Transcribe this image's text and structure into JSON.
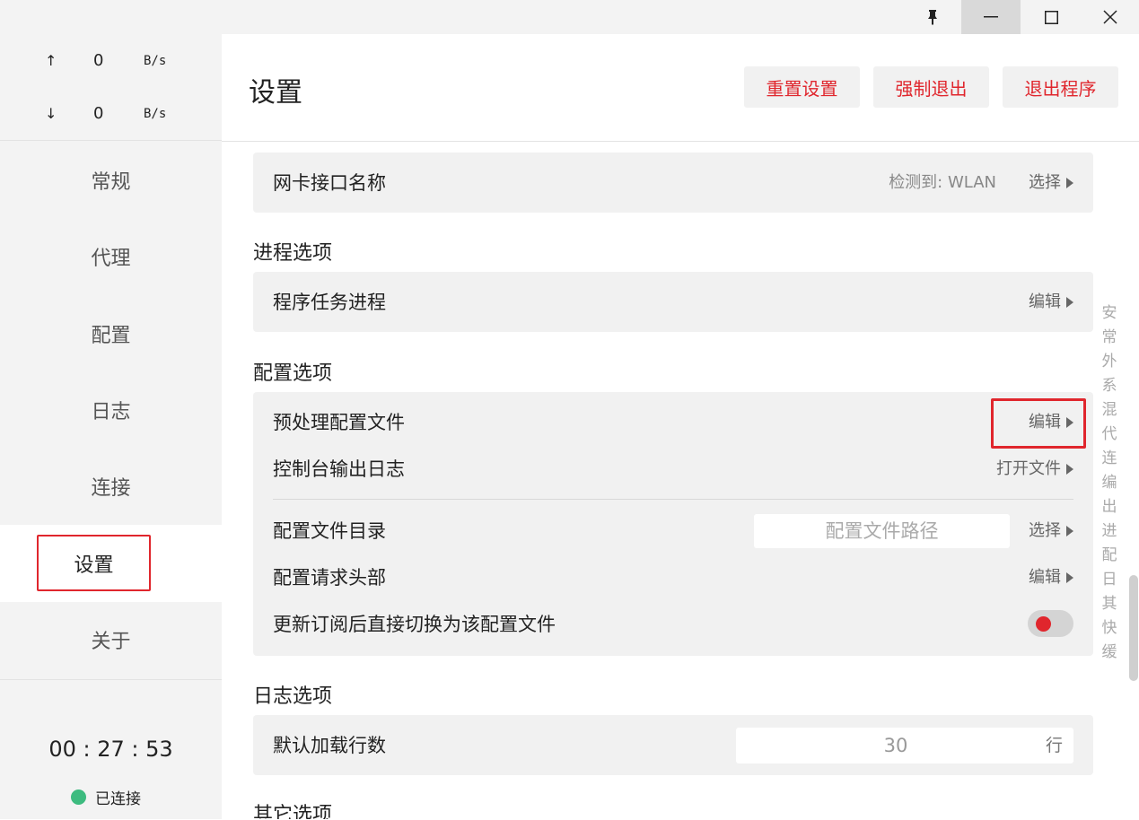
{
  "window": {
    "pin_icon": "pin-icon",
    "minimize_icon": "minimize-icon",
    "maximize_icon": "maximize-icon",
    "close_icon": "close-icon"
  },
  "traffic": {
    "upload": {
      "arrow": "↑",
      "value": "0",
      "unit": "B/s"
    },
    "download": {
      "arrow": "↓",
      "value": "0",
      "unit": "B/s"
    }
  },
  "nav": {
    "items": [
      "常规",
      "代理",
      "配置",
      "日志",
      "连接",
      "设置",
      "关于"
    ],
    "active": "设置"
  },
  "status": {
    "timer": "00 : 27 : 53",
    "connection": "已连接",
    "dot_color": "#3dbb7f"
  },
  "header": {
    "title": "设置",
    "reset_label": "重置设置",
    "force_quit_label": "强制退出",
    "exit_label": "退出程序",
    "accent_color": "#e0262d"
  },
  "settings": {
    "nic": {
      "label": "网卡接口名称",
      "detected": "检测到: WLAN",
      "action": "选择"
    },
    "process_section": "进程选项",
    "process_task": {
      "label": "程序任务进程",
      "action": "编辑"
    },
    "profile_section": "配置选项",
    "preprocess": {
      "label": "预处理配置文件",
      "action": "编辑"
    },
    "console_log": {
      "label": "控制台输出日志",
      "action": "打开文件"
    },
    "profile_dir": {
      "label": "配置文件目录",
      "placeholder": "配置文件路径",
      "action": "选择"
    },
    "request_headers": {
      "label": "配置请求头部",
      "action": "编辑"
    },
    "auto_switch": {
      "label": "更新订阅后直接切换为该配置文件",
      "enabled": false
    },
    "log_section": "日志选项",
    "default_lines": {
      "label": "默认加载行数",
      "value": "30",
      "unit": "行"
    },
    "other_section": "其它选项"
  },
  "quicknav": [
    "安",
    "常",
    "外",
    "系",
    "混",
    "代",
    "连",
    "编",
    "出",
    "进",
    "配",
    "日",
    "其",
    "快",
    "缓"
  ]
}
